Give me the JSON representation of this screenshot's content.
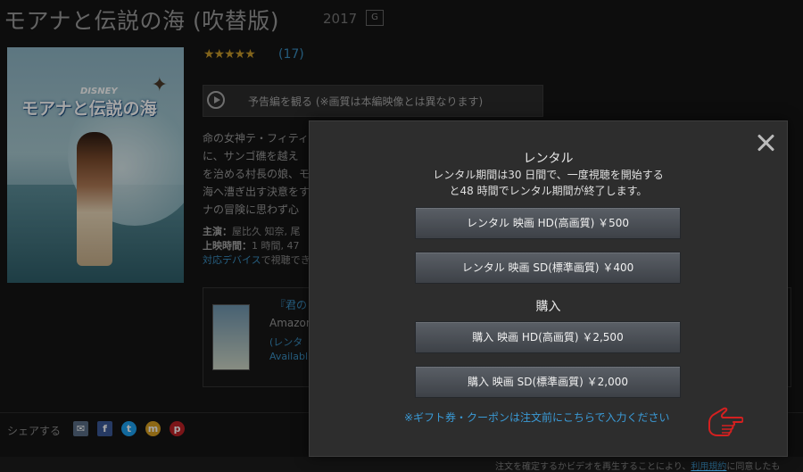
{
  "page": {
    "title": "モアナと伝説の海 (吹替版)",
    "year": "2017",
    "rating_badge": "G",
    "poster": {
      "brand": "DISNEY",
      "title": "モアナと伝説の海"
    },
    "stars": "★★★★★",
    "review_count": "(17)",
    "trailer_label": "予告編を観る (※画質は本編映像とは異なります)",
    "description_lines": [
      "命の女神テ・フィティ",
      "に、サンゴ礁を越え",
      "を治める村長の娘、モ",
      "海へ漕ぎ出す決意をす",
      "ナの冒険に思わず心"
    ],
    "meta": {
      "cast_label": "主演：",
      "cast_value": "屋比久 知奈, 尾",
      "runtime_label": "上映時間：",
      "runtime_value": "1 時間, 47",
      "devices_link": "対応デバイス",
      "devices_text": "で視聴でき"
    },
    "related": {
      "line1": "『君の",
      "line2": "Amazon",
      "line3": "(レンタ",
      "line4": "Availabl"
    },
    "share_label": "シェアする",
    "footer": {
      "text": "注文を確定するかビデオを再生することにより、",
      "link": "利用規約",
      "text2": "に同意したも"
    },
    "colors": {
      "link": "#3a9ad6",
      "star": "#c89a2a",
      "modal_bg": "#2d2d2d"
    }
  },
  "modal": {
    "rental_heading": "レンタル",
    "rental_line1": "レンタル期間は30 日間で、一度視聴を開始する",
    "rental_line2": "と48 時間でレンタル期間が終了します。",
    "rent_hd": "レンタル 映画 HD(高画質) ￥500",
    "rent_sd": "レンタル 映画 SD(標準画質) ￥400",
    "purchase_heading": "購入",
    "buy_hd": "購入 映画 HD(高画質) ￥2,500",
    "buy_sd": "購入 映画 SD(標準画質) ￥2,000",
    "gift_link": "※ギフト券・クーポンは注文前にこちらで入力ください",
    "close_icon": "close-icon"
  }
}
